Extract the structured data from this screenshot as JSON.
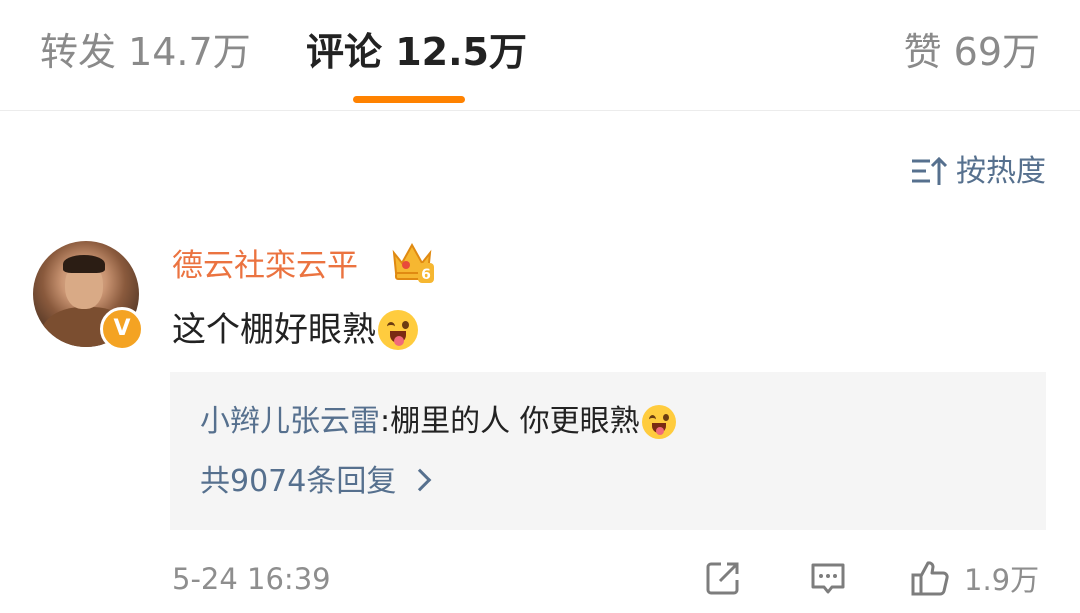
{
  "tabs": {
    "repost": "转发 14.7万",
    "comment": "评论 12.5万",
    "like": "赞 69万",
    "accent_color": "#ff8200"
  },
  "sort": {
    "icon": "sort-icon",
    "label": "按热度"
  },
  "comment": {
    "author": "德云社栾云平",
    "author_color": "#eb7340",
    "badge_level": "6",
    "verified_badge": "V",
    "text": "这个棚好眼熟",
    "emoji": "tongue-wink-emoji",
    "reply_preview": {
      "author": "小辫儿张云雷",
      "separator": ":",
      "text": " 棚里的人 你更眼熟",
      "emoji": "tongue-wink-emoji",
      "more": "共9074条回复"
    },
    "timestamp": "5-24 16:39",
    "like_count": "1.9万",
    "link_color": "#56708e"
  }
}
